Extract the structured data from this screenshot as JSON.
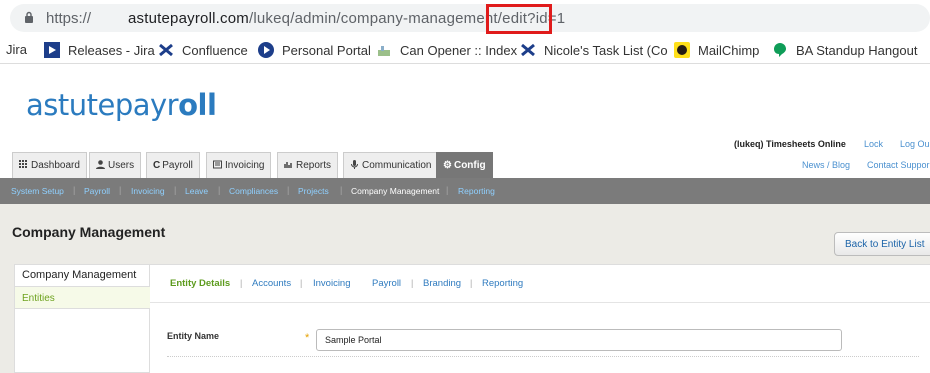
{
  "browser": {
    "url_proto": "https://",
    "url_host": "astutepayroll.com",
    "url_path": "/lukeq/admin/company-management/edit?id=1"
  },
  "bookmarks": [
    {
      "label": "Jira",
      "icon": "jira-icon"
    },
    {
      "label": "Releases - Jira",
      "icon": "releases-icon"
    },
    {
      "label": "Confluence",
      "icon": "confluence-icon"
    },
    {
      "label": "Personal Portal",
      "icon": "portal-icon"
    },
    {
      "label": "Can Opener :: Index",
      "icon": "can-opener-icon"
    },
    {
      "label": "Nicole's Task List (Co",
      "icon": "tasklist-icon"
    },
    {
      "label": "MailChimp",
      "icon": "mailchimp-icon"
    },
    {
      "label": "BA Standup Hangout",
      "icon": "hangout-icon"
    }
  ],
  "logo": {
    "part1": "astutepayr",
    "part2": "oll"
  },
  "user": {
    "name": "(lukeq) Timesheets Online",
    "lock": "Lock",
    "logout": "Log Ou",
    "news": "News / Blog",
    "support": "Contact Suppor"
  },
  "tabs": [
    {
      "label": "Dashboard",
      "icon": "grid-icon"
    },
    {
      "label": "Users",
      "icon": "user-icon"
    },
    {
      "label": "Payroll",
      "icon": "refresh-icon"
    },
    {
      "label": "Invoicing",
      "icon": "invoice-icon"
    },
    {
      "label": "Reports",
      "icon": "chart-icon"
    },
    {
      "label": "Communication",
      "icon": "mic-icon"
    },
    {
      "label": "Config",
      "icon": "gear-icon"
    }
  ],
  "subnav": [
    "System Setup",
    "Payroll",
    "Invoicing",
    "Leave",
    "Compliances",
    "Projects",
    "Company Management",
    "Reporting"
  ],
  "page": {
    "title": "Company Management",
    "back_button": "Back to Entity List"
  },
  "sidebar": {
    "heading": "Company Management",
    "items": [
      "Entities"
    ]
  },
  "entity_tabs": [
    "Entity Details",
    "Accounts",
    "Invoicing",
    "Payroll",
    "Branding",
    "Reporting"
  ],
  "form": {
    "entity_name_label": "Entity Name",
    "entity_name_value": "Sample Portal",
    "required_mark": "*"
  }
}
